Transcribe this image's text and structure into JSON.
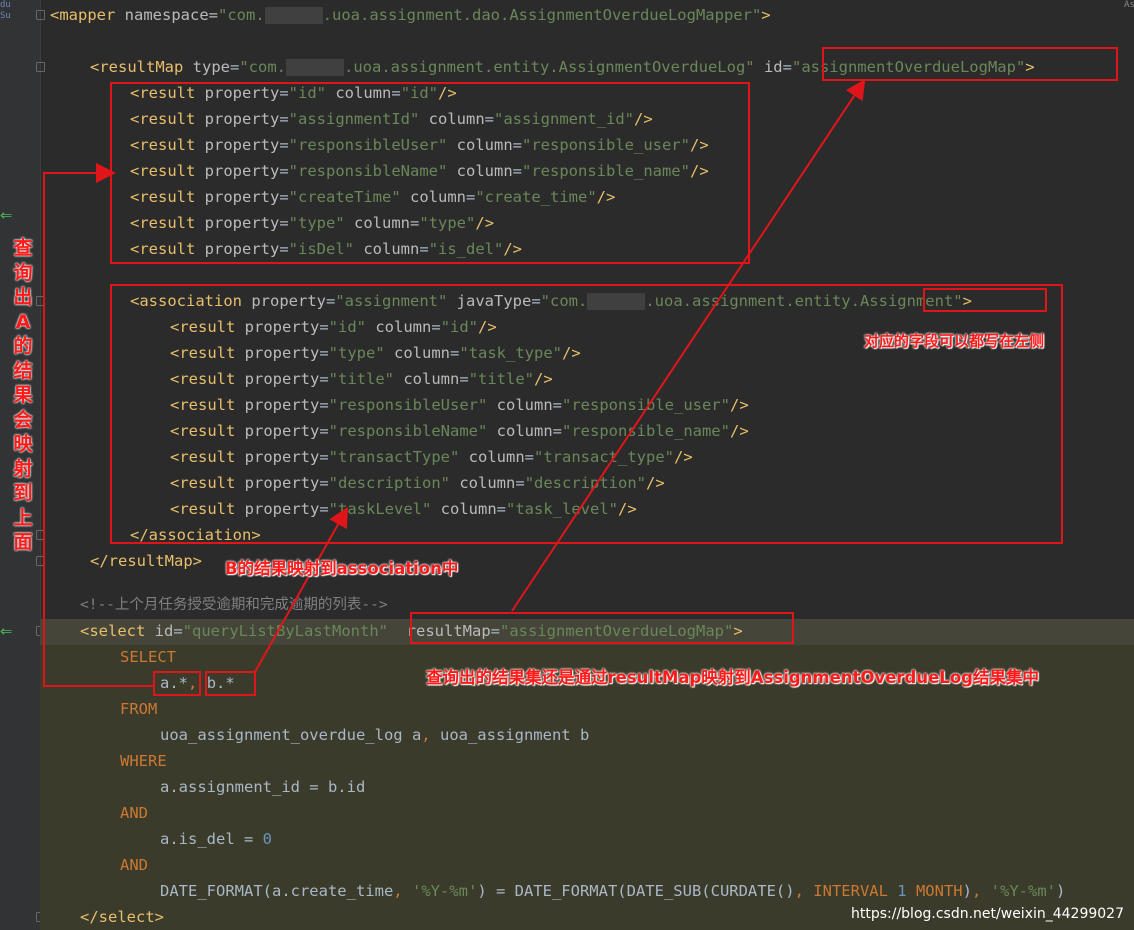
{
  "gutter": {
    "top_text": "du\nSu"
  },
  "right_edge_text": "As",
  "code": {
    "mapper_open": {
      "tag": "<mapper",
      "attr": "namespace",
      "eq": "=",
      "val1": "\"com.",
      "val2": ".uoa.assignment.dao.AssignmentOverdueLogMapper\"",
      "end": ">"
    },
    "resultmap_open": {
      "tag": "<resultMap",
      "attr": "type",
      "eq": "=",
      "val1": "\"com.",
      "val2": ".uoa.assignment.entity.AssignmentOverdueLog\"",
      "id_attr": "id",
      "id_val": "\"assignmentOverdueLogMap\"",
      "end": ">"
    },
    "results_a": [
      {
        "property": "\"id\"",
        "column": "\"id\""
      },
      {
        "property": "\"assignmentId\"",
        "column": "\"assignment_id\""
      },
      {
        "property": "\"responsibleUser\"",
        "column": "\"responsible_user\""
      },
      {
        "property": "\"responsibleName\"",
        "column": "\"responsible_name\""
      },
      {
        "property": "\"createTime\"",
        "column": "\"create_time\""
      },
      {
        "property": "\"type\"",
        "column": "\"type\""
      },
      {
        "property": "\"isDel\"",
        "column": "\"is_del\""
      }
    ],
    "association_open": {
      "tag": "<association",
      "attr": "property",
      "val": "\"assignment\"",
      "attr2": "javaType",
      "val2a": "\"com.",
      "val2b": ".uoa.assignment.entity.",
      "val2c": "Assignment\"",
      "end": ">"
    },
    "results_b": [
      {
        "property": "\"id\"",
        "column": "\"id\""
      },
      {
        "property": "\"type\"",
        "column": "\"task_type\""
      },
      {
        "property": "\"title\"",
        "column": "\"title\""
      },
      {
        "property": "\"responsibleUser\"",
        "column": "\"responsible_user\""
      },
      {
        "property": "\"responsibleName\"",
        "column": "\"responsible_name\""
      },
      {
        "property": "\"transactType\"",
        "column": "\"transact_type\""
      },
      {
        "property": "\"description\"",
        "column": "\"description\""
      },
      {
        "property": "\"taskLevel\"",
        "column": "\"task_level\""
      }
    ],
    "result_tag": "<result",
    "property_attr": "property",
    "column_attr": "column",
    "self_close": "/>",
    "association_close": "</association>",
    "resultmap_close": "</resultMap>",
    "comment": "<!--上个月任务授受逾期和完成逾期的列表-->",
    "select_open": {
      "tag": "<select",
      "attr": "id",
      "val": "\"queryListByLastMonth\"",
      "attr2": "resultMap",
      "val2": "\"assignmentOverdueLogMap\"",
      "end": ">"
    },
    "sql": {
      "select_kw": "SELECT",
      "cols_a": "a.*",
      "comma": ",",
      "cols_b": "b.*",
      "from_kw": "FROM",
      "tables_1": "uoa_assignment_overdue_log a",
      "tables_2": "uoa_assignment b",
      "where_kw": "WHERE",
      "cond1": "a.assignment_id = b.id",
      "and_kw": "AND",
      "cond2": "a.is_del = ",
      "cond2_num": "0",
      "cond3_a": "DATE_FORMAT(a.create_time",
      "cond3_fmt": "'%Y-%m'",
      "cond3_b": ") = DATE_FORMAT(DATE_SUB(CURDATE()",
      "cond3_interval": "INTERVAL",
      "cond3_one": "1",
      "cond3_month": "MONTH",
      "cond3_c": ")"
    },
    "select_close": "</select>"
  },
  "annotations": {
    "vertical": "查询出A的结果会映射到上面",
    "right_side": "对应的字段可以都写在左侧",
    "b_mapping": "B的结果映射到association中",
    "result_set": "查询出的结果集还是通过resultMap映射到AssignmentOverdueLog结果集中"
  },
  "watermark": "https://blog.csdn.net/weixin_44299027",
  "colors": {
    "annotation": "#e0151a",
    "tag": "#e8bf6a",
    "string": "#6a8759",
    "keyword": "#cc7832"
  }
}
